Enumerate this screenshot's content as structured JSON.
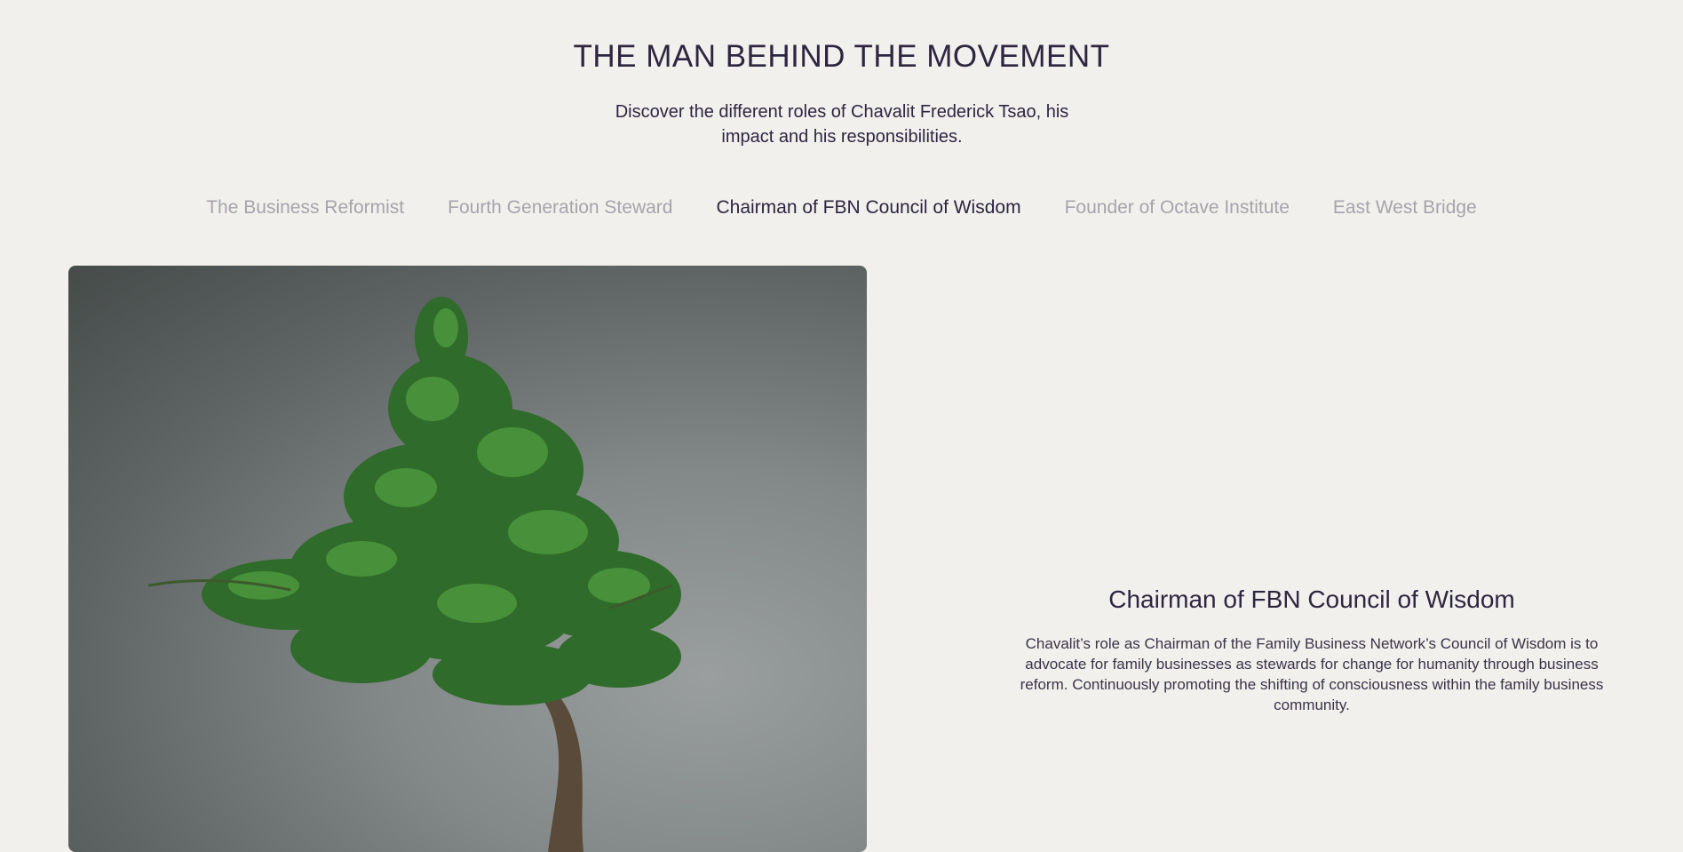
{
  "header": {
    "title": "THE MAN BEHIND THE MOVEMENT",
    "subtitle": "Discover the different roles of Chavalit Frederick Tsao, his impact and his responsibilities."
  },
  "tabs": [
    {
      "label": "The Business Reformist",
      "active": false
    },
    {
      "label": "Fourth Generation Steward",
      "active": false
    },
    {
      "label": "Chairman of FBN Council of Wisdom",
      "active": true
    },
    {
      "label": "Founder of Octave Institute",
      "active": false
    },
    {
      "label": "East West Bridge",
      "active": false
    }
  ],
  "detail": {
    "title": "Chairman of FBN Council of Wisdom",
    "text": "Chavalit’s role as Chairman of the Family Business Network’s Council of Wisdom is to advocate for family businesses as stewards for change for humanity through business reform. Continuously promoting the shifting of consciousness within the family business community."
  },
  "colors": {
    "background": "#f2f0ed",
    "text_primary": "#2e2540",
    "tab_inactive": "#a7a3ab",
    "leaf": "#2f6b2a"
  },
  "image": {
    "subject": "bonsai-tree-photo"
  }
}
